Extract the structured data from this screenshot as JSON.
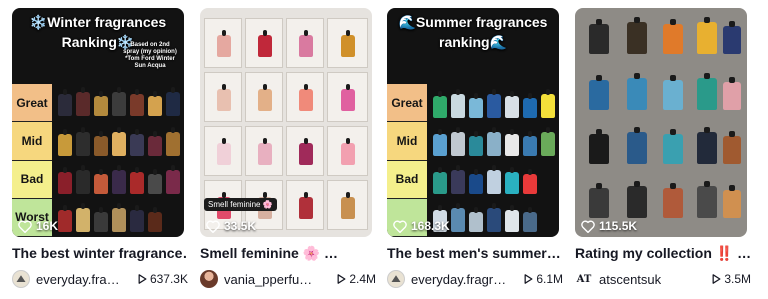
{
  "videos": [
    {
      "thumb_title": "❄️Winter fragrances Ranking❄️",
      "thumb_note": "Based on 2nd spray (my opinion) *Tom Ford Winter Sun Acqua",
      "tiers": [
        "Great",
        "Mid",
        "Bad",
        "Worst"
      ],
      "likes": "16K",
      "title": "The best winter fragrance…",
      "author": "everyday.fra…",
      "views": "637.3K",
      "avatar_color": "#e9e2d3"
    },
    {
      "thumb_badge": "Smell feminine 🌸",
      "likes": "33.5K",
      "title": "Smell feminine 🌸 …",
      "author": "vania_pperfu…",
      "views": "2.4M",
      "avatar_color": "#b06a55"
    },
    {
      "thumb_title": "🌊Summer fragrances ranking🌊",
      "tiers": [
        "Great",
        "Mid",
        "Bad",
        ""
      ],
      "likes": "168.3K",
      "title": "The best men's summer…",
      "author": "everyday.fragr…",
      "views": "6.1M",
      "avatar_color": "#e9e2d3"
    },
    {
      "likes": "115.5K",
      "title": "Rating my collection ‼️ …",
      "author": "atscentsuk",
      "avatar_text": "AT",
      "views": "3.5M",
      "avatar_color": "#ffffff"
    }
  ],
  "colors": {
    "text": "#161823",
    "great": "#f2bf88",
    "mid": "#f6d77e",
    "bad": "#f4ef8c",
    "worst": "#bfe59a"
  },
  "icons": [
    "heart-icon",
    "play-icon",
    "avatar"
  ]
}
